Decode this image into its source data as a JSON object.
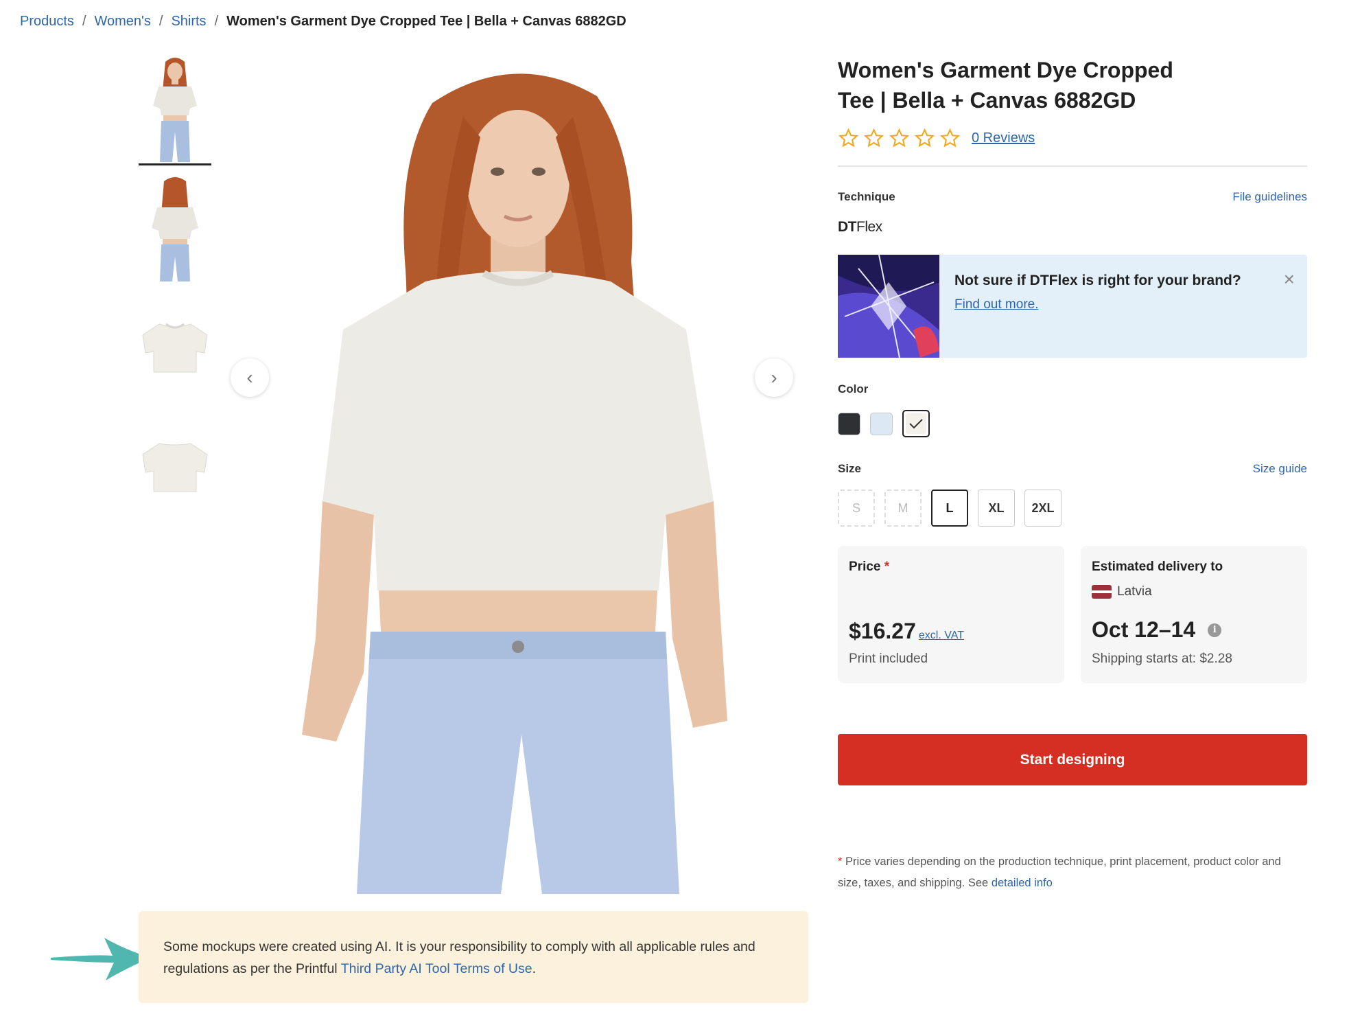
{
  "breadcrumb": {
    "items": [
      "Products",
      "Women's",
      "Shirts"
    ],
    "current": "Women's Garment Dye Cropped Tee | Bella + Canvas 6882GD",
    "separator": "/"
  },
  "product": {
    "title": "Women's Garment Dye Cropped Tee | Bella + Canvas 6882GD",
    "reviews_label": "0 Reviews",
    "rating": 0,
    "stars": 5
  },
  "technique": {
    "label": "Technique",
    "guidelines_link": "File guidelines",
    "logo_bold": "DT",
    "logo_thin": "Flex"
  },
  "promo": {
    "title": "Not sure if DTFlex is right for your brand?",
    "link": "Find out more.",
    "close_icon": "close-icon"
  },
  "color": {
    "label": "Color",
    "swatches": [
      "#2e3033",
      "#dce8f3",
      "#f3f1ea"
    ],
    "selected_index": 2
  },
  "size": {
    "label": "Size",
    "guide_link": "Size guide",
    "options": [
      {
        "label": "S",
        "available": false
      },
      {
        "label": "M",
        "available": false
      },
      {
        "label": "L",
        "available": true,
        "selected": true
      },
      {
        "label": "XL",
        "available": true
      },
      {
        "label": "2XL",
        "available": true
      }
    ]
  },
  "price_card": {
    "title": "Price",
    "asterisk": "*",
    "amount": "$16.27",
    "vat": "excl. VAT",
    "note": "Print included"
  },
  "delivery_card": {
    "title": "Estimated delivery to",
    "country": "Latvia",
    "dates": "Oct 12–14",
    "info_icon": "i",
    "shipping": "Shipping starts at: $2.28"
  },
  "cta": {
    "label": "Start designing"
  },
  "footnote": {
    "asterisk": "*",
    "text": " Price varies depending on the production technique, print placement, product color and size, taxes, and shipping. See ",
    "link": "detailed info"
  },
  "ai_notice": {
    "text": "Some mockups were created using AI. It is your responsibility to comply with all applicable rules and regulations as per the Printful ",
    "link": "Third Party AI Tool Terms of Use",
    "end": "."
  },
  "gallery": {
    "prev_icon": "chevron-left-icon",
    "next_icon": "chevron-right-icon",
    "thumbnail_count": 4,
    "active_thumbnail": 0
  },
  "colors": {
    "link": "#2d66ad",
    "cta": "#d52f23",
    "star": "#f0a81c",
    "notice_bg": "#fbf1dc",
    "promo_bg": "#e3f0f9",
    "arrow": "#4fb7ad"
  }
}
